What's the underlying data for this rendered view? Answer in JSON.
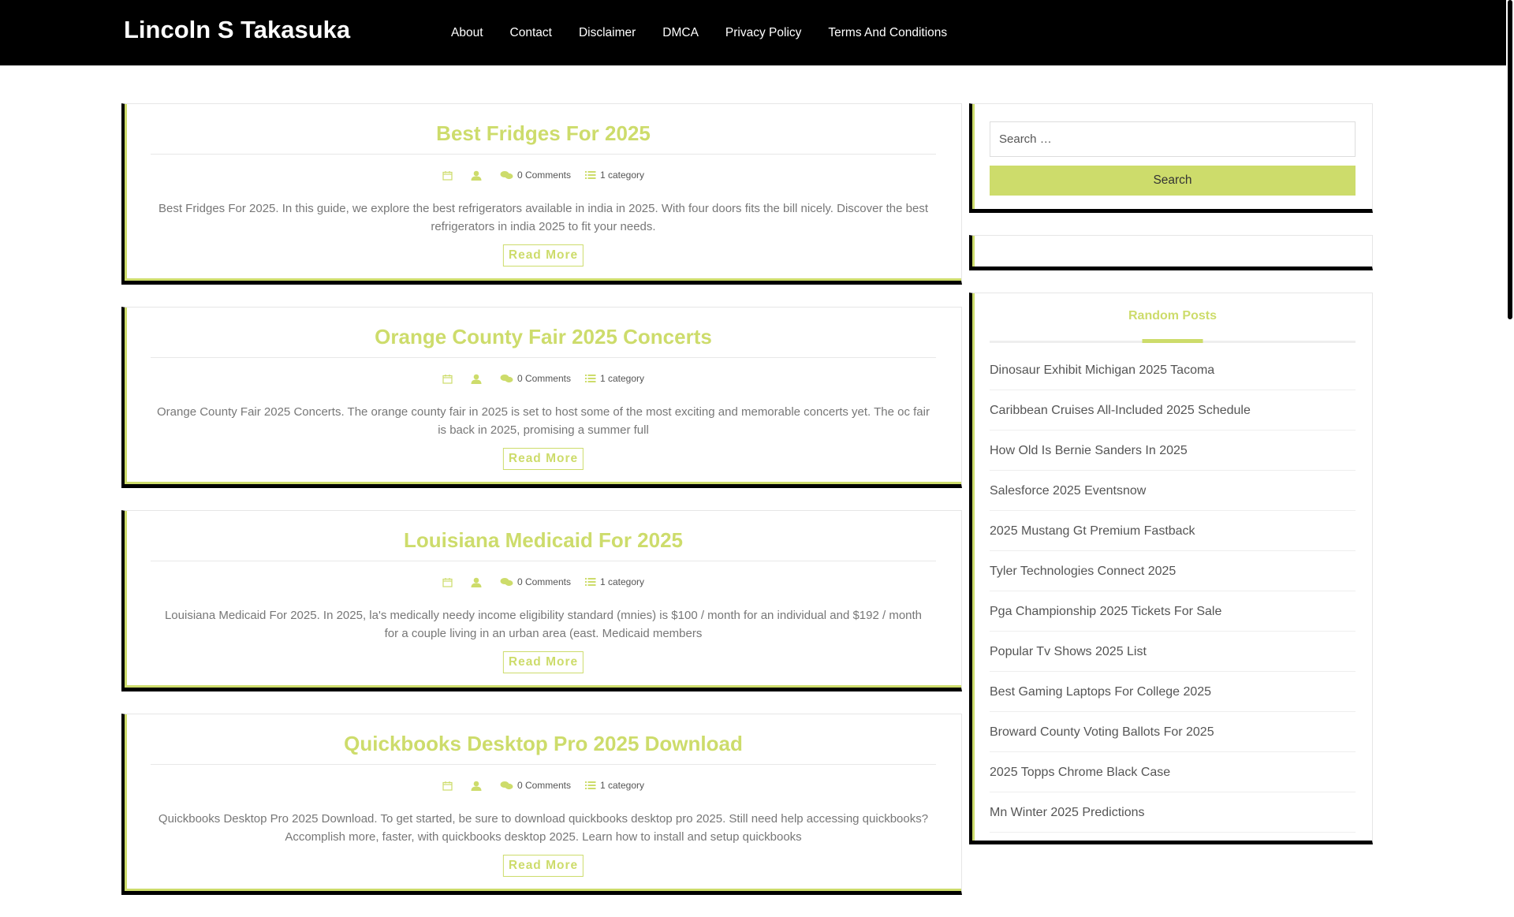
{
  "site": {
    "title": "Lincoln S Takasuka"
  },
  "nav": [
    {
      "label": "About"
    },
    {
      "label": "Contact"
    },
    {
      "label": "Disclaimer"
    },
    {
      "label": "DMCA"
    },
    {
      "label": "Privacy Policy"
    },
    {
      "label": "Terms And Conditions"
    }
  ],
  "colors": {
    "accent": "#cddc6b",
    "header_bg": "#000000",
    "text": "#555555"
  },
  "posts": [
    {
      "title": "Best Fridges For 2025",
      "comments": "0 Comments",
      "category": "1 category",
      "excerpt": "Best Fridges For 2025. In this guide, we explore the best refrigerators available in india in 2025. With four doors fits the bill nicely. Discover the best refrigerators in india 2025 to fit your needs.",
      "read_more": "Read More"
    },
    {
      "title": "Orange County Fair 2025 Concerts",
      "comments": "0 Comments",
      "category": "1 category",
      "excerpt": "Orange County Fair 2025 Concerts. The orange county fair in 2025 is set to host some of the most exciting and memorable concerts yet. The oc fair is back in 2025, promising a summer full",
      "read_more": "Read More"
    },
    {
      "title": "Louisiana Medicaid For 2025",
      "comments": "0 Comments",
      "category": "1 category",
      "excerpt": "Louisiana Medicaid For 2025. In 2025, la's medically needy income eligibility standard (mnies) is $100 / month for an individual and $192 / month for a couple living in an urban area (east. Medicaid members",
      "read_more": "Read More"
    },
    {
      "title": "Quickbooks Desktop Pro 2025 Download",
      "comments": "0 Comments",
      "category": "1 category",
      "excerpt": "Quickbooks Desktop Pro 2025 Download. To get started, be sure to download quickbooks desktop pro 2025. Still need help accessing quickbooks? Accomplish more, faster, with quickbooks desktop 2025. Learn how to install and setup quickbooks",
      "read_more": "Read More"
    }
  ],
  "search": {
    "placeholder": "Search …",
    "button_label": "Search"
  },
  "random_posts": {
    "title": "Random Posts",
    "items": [
      "Dinosaur Exhibit Michigan 2025 Tacoma",
      "Caribbean Cruises All-Included 2025 Schedule",
      "How Old Is Bernie Sanders In 2025",
      "Salesforce 2025 Eventsnow",
      "2025 Mustang Gt Premium Fastback",
      "Tyler Technologies Connect 2025",
      "Pga Championship 2025 Tickets For Sale",
      "Popular Tv Shows 2025 List",
      "Best Gaming Laptops For College 2025",
      "Broward County Voting Ballots For 2025",
      "2025 Topps Chrome Black Case",
      "Mn Winter 2025 Predictions"
    ]
  }
}
